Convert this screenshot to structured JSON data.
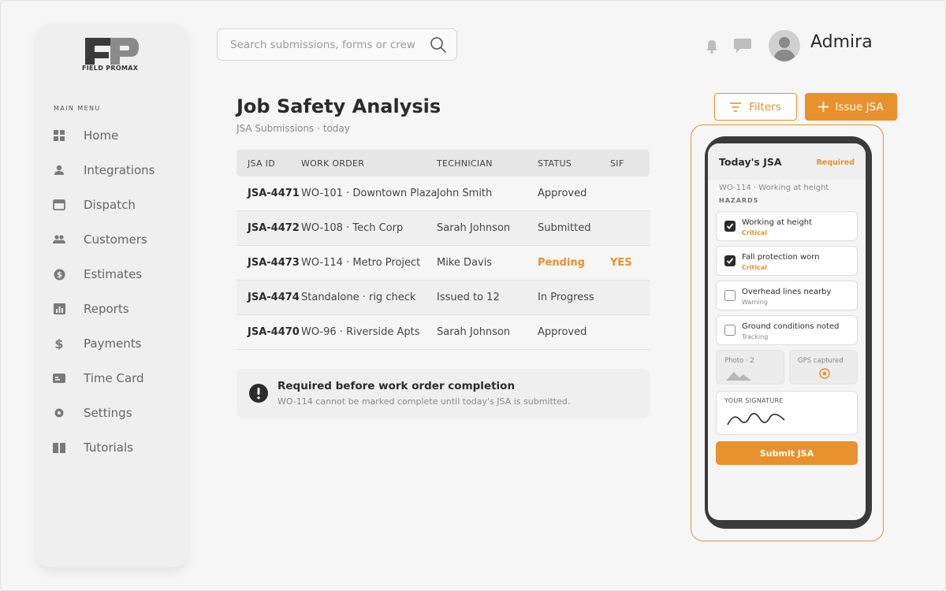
{
  "brand": {
    "logo_text": "FIELD PROMAX",
    "accent_color": "#e8912d"
  },
  "sidebar": {
    "menu_title": "MAIN MENU",
    "items": [
      {
        "label": "Home",
        "icon": "grid-icon"
      },
      {
        "label": "Integrations",
        "icon": "user-icon"
      },
      {
        "label": "Dispatch",
        "icon": "window-icon"
      },
      {
        "label": "Customers",
        "icon": "users-icon"
      },
      {
        "label": "Estimates",
        "icon": "dollar-circle-icon"
      },
      {
        "label": "Reports",
        "icon": "bar-chart-icon"
      },
      {
        "label": "Payments",
        "icon": "dollar-icon"
      },
      {
        "label": "Time Card",
        "icon": "card-icon"
      },
      {
        "label": "Settings",
        "icon": "gear-icon"
      },
      {
        "label": "Tutorials",
        "icon": "book-icon"
      }
    ]
  },
  "search": {
    "placeholder": "Search submissions, forms or crew",
    "value": ""
  },
  "header": {
    "username": "Admira"
  },
  "page": {
    "title": "Job Safety Analysis",
    "subtitle": "JSA Submissions · today",
    "filters_label": "Filters",
    "issue_label": "Issue JSA"
  },
  "table": {
    "columns": [
      "JSA ID",
      "WORK ORDER",
      "TECHNICIAN",
      "STATUS",
      "SIF"
    ],
    "rows": [
      {
        "id": "JSA-4471",
        "work_order": "WO-101 · Downtown Plaza",
        "technician": "John Smith",
        "status": "Approved",
        "sif": ""
      },
      {
        "id": "JSA-4472",
        "work_order": "WO-108 · Tech Corp",
        "technician": "Sarah Johnson",
        "status": "Submitted",
        "sif": ""
      },
      {
        "id": "JSA-4473",
        "work_order": "WO-114 · Metro Project",
        "technician": "Mike Davis",
        "status": "Pending",
        "sif": "YES"
      },
      {
        "id": "JSA-4474",
        "work_order": "Standalone · rig check",
        "technician": "Issued to 12",
        "status": "In Progress",
        "sif": ""
      },
      {
        "id": "JSA-4470",
        "work_order": "WO-96 · Riverside Apts",
        "technician": "Sarah Johnson",
        "status": "Approved",
        "sif": ""
      }
    ]
  },
  "notice": {
    "title": "Required before work order completion",
    "text": "WO-114 cannot be marked complete until today's JSA is submitted."
  },
  "phone": {
    "title": "Today's JSA",
    "required": "Required",
    "work_order": "WO-114 · Working at height",
    "hazards_label": "HAZARDS",
    "hazards": [
      {
        "name": "Working at height",
        "severity": "Critical",
        "checked": true
      },
      {
        "name": "Fall protection worn",
        "severity": "Critical",
        "checked": true
      },
      {
        "name": "Overhead lines nearby",
        "severity": "Warning",
        "checked": false
      },
      {
        "name": "Ground conditions noted",
        "severity": "Tracking",
        "checked": false
      }
    ],
    "photo_label": "Photo · 2",
    "gps_label": "GPS captured",
    "signature_label": "YOUR SIGNATURE",
    "submit_label": "Submit JSA"
  }
}
